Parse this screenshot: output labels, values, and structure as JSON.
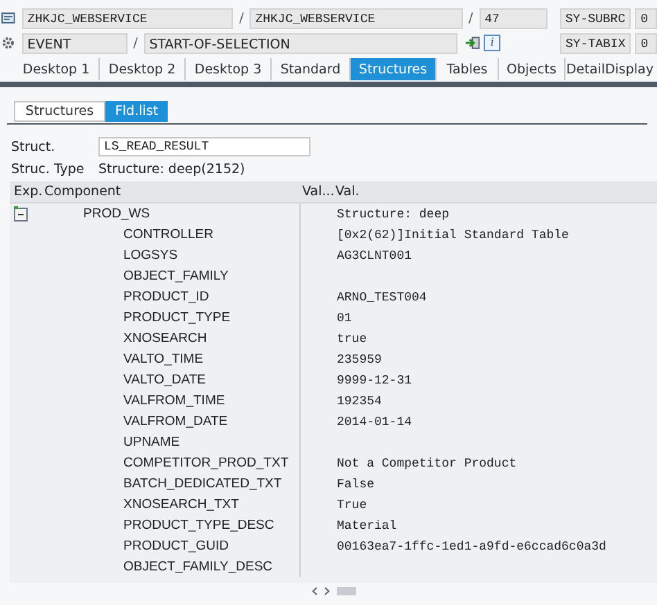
{
  "header": {
    "program": "ZHKJC_WEBSERVICE",
    "include": "ZHKJC_WEBSERVICE",
    "line": "47",
    "event_label": "EVENT",
    "event": "START-OF-SELECTION",
    "info_button": "i",
    "separators": [
      "/",
      "/",
      "/"
    ],
    "sysvars": [
      {
        "name": "SY-SUBRC",
        "value": "0"
      },
      {
        "name": "SY-TABIX",
        "value": "0"
      }
    ]
  },
  "tabs": [
    {
      "label": "Desktop 1",
      "selected": false
    },
    {
      "label": "Desktop 2",
      "selected": false
    },
    {
      "label": "Desktop 3",
      "selected": false
    },
    {
      "label": "Standard",
      "selected": false
    },
    {
      "label": "Structures",
      "selected": true
    },
    {
      "label": "Tables",
      "selected": false
    },
    {
      "label": "Objects",
      "selected": false
    },
    {
      "label": "DetailDisplay",
      "selected": false
    }
  ],
  "subtabs": [
    {
      "label": "Structures",
      "selected": false
    },
    {
      "label": "Fld.list",
      "selected": true
    }
  ],
  "struct": {
    "label": "Struct.",
    "value": "LS_READ_RESULT",
    "type_label": "Struc. Type",
    "type": "Structure: deep(2152)"
  },
  "table": {
    "columns": [
      "Exp.",
      "Component",
      "Val...",
      "Val."
    ],
    "rows": [
      {
        "component": "PROD_WS",
        "value": "Structure: deep",
        "expanded": true,
        "children": [
          {
            "component": "CONTROLLER",
            "value": "[0x2(62)]Initial Standard Table"
          },
          {
            "component": "LOGSYS",
            "value": "AG3CLNT001"
          },
          {
            "component": "OBJECT_FAMILY"
          },
          {
            "component": "PRODUCT_ID",
            "value": "ARNO_TEST004"
          },
          {
            "component": "PRODUCT_TYPE",
            "value": "01"
          },
          {
            "component": "XNOSEARCH",
            "value": "true"
          },
          {
            "component": "VALTO_TIME",
            "value": "235959"
          },
          {
            "component": "VALTO_DATE",
            "value": "9999-12-31"
          },
          {
            "component": "VALFROM_TIME",
            "value": "192354"
          },
          {
            "component": "VALFROM_DATE",
            "value": "2014-01-14"
          },
          {
            "component": "UPNAME"
          },
          {
            "component": "COMPETITOR_PROD_TXT",
            "value": "Not a Competitor Product"
          },
          {
            "component": "BATCH_DEDICATED_TXT",
            "value": "False"
          },
          {
            "component": "XNOSEARCH_TXT",
            "value": "True"
          },
          {
            "component": "PRODUCT_TYPE_DESC",
            "value": "Material"
          },
          {
            "component": "PRODUCT_GUID",
            "value": "00163ea7-1ffc-1ed1-a9fd-e6ccad6c0a3d"
          },
          {
            "component": "OBJECT_FAMILY_DESC"
          }
        ]
      }
    ]
  }
}
